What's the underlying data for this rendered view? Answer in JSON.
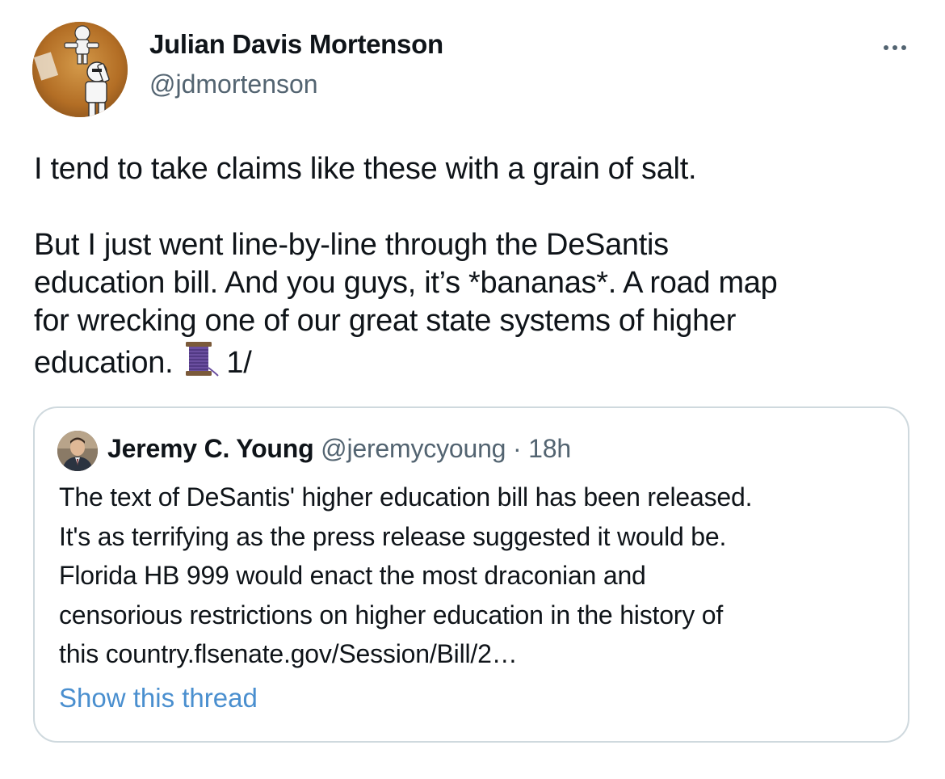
{
  "author": {
    "display_name": "Julian Davis Mortenson",
    "handle": "@jdmortenson",
    "avatar_icon": "stormtrooper-avatar"
  },
  "more_icon": "more-horizontal-icon",
  "tweet": {
    "line1": "I tend to take claims like these with a grain of salt.",
    "line2": "But I just went line-by-line through the DeSantis",
    "line3": "education bill. And you guys, it’s *bananas*. A road map",
    "line4": "for wrecking one of our great state systems of higher",
    "line5_start": "education.",
    "thread_emoji": "thread-spool-icon",
    "line5_end": "1/"
  },
  "quote": {
    "display_name": "Jeremy C. Young",
    "handle": "@jeremycyoung",
    "separator": "·",
    "time": "18h",
    "lines": [
      "The text of DeSantis' higher education bill has been released.",
      "It's as terrifying as the press release suggested it would be.",
      "Florida HB 999 would enact the most draconian and",
      "censorious restrictions on higher education in the history of",
      "this country.flsenate.gov/Session/Bill/2…"
    ],
    "show_thread": "Show this thread"
  },
  "colors": {
    "text": "#0f1419",
    "secondary": "#536471",
    "link": "#4a8fcf",
    "border": "#cfd9de",
    "thread_purple": "#6b4fa0"
  }
}
